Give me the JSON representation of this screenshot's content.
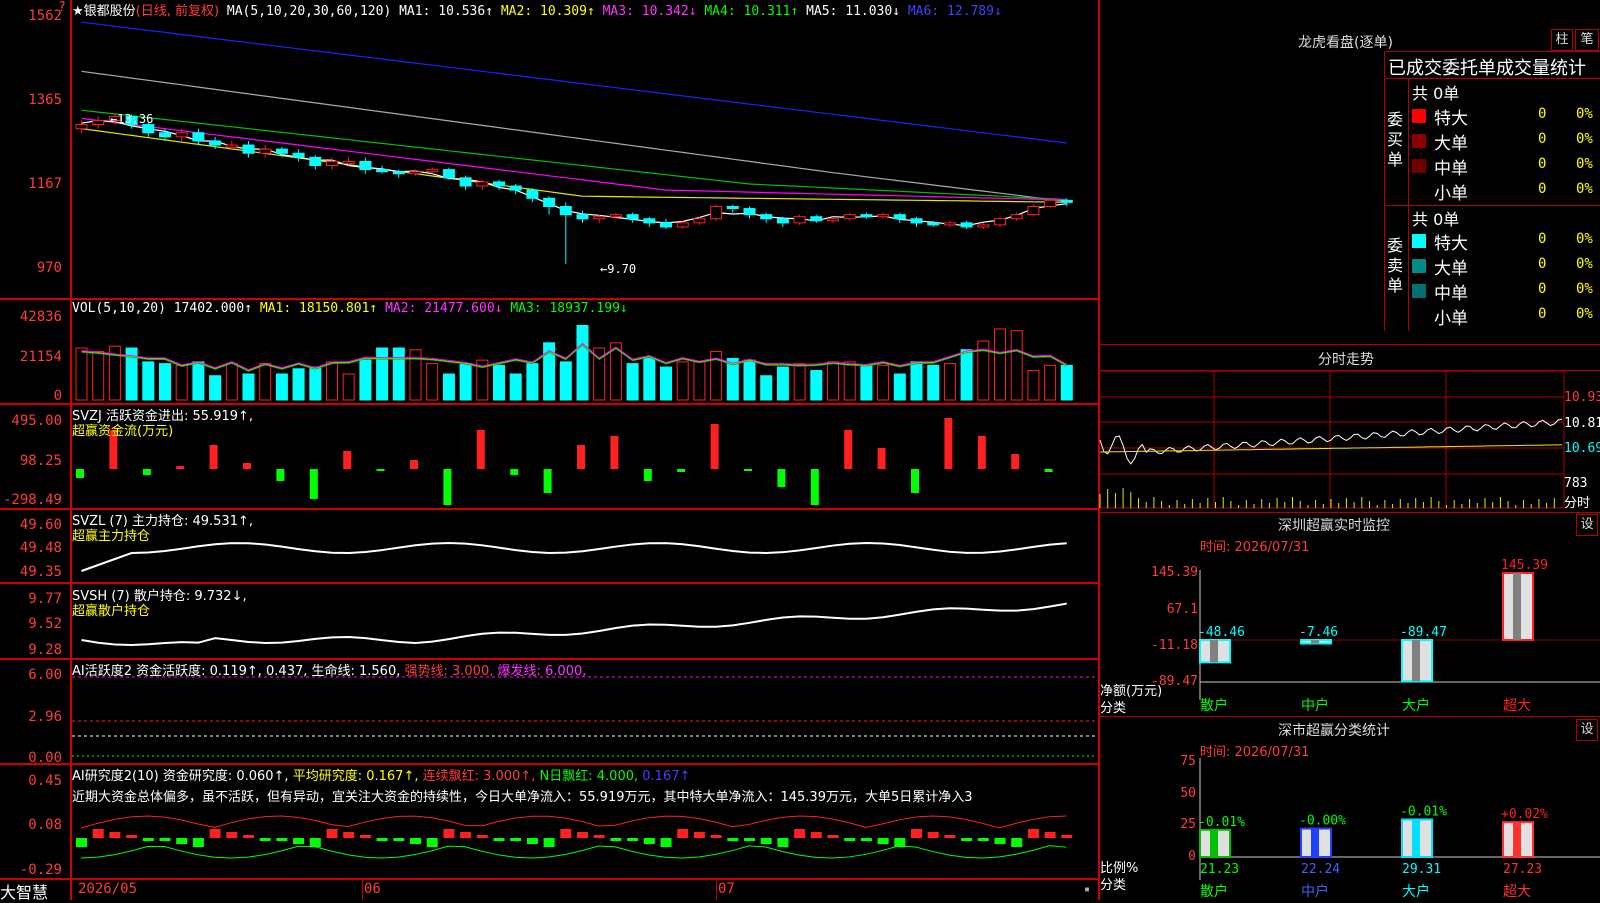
{
  "stock": {
    "name": "★银都股份",
    "mode": "(日线, 前复权)",
    "ma_label": "MA(5,10,20,30,60,120)",
    "ma1": "MA1: 10.536↑",
    "ma2": "MA2: 10.309↑",
    "ma3": "MA3: 10.342↓",
    "ma4": "MA4: 10.311↑",
    "ma5": "MA5: 11.030↓",
    "ma6": "MA6: 12.789↓"
  },
  "price_axis": [
    "1562",
    "1365",
    "1167",
    "970"
  ],
  "annotations": {
    "high": "←13.36",
    "low": "←9.70"
  },
  "vol": {
    "title": "VOL(5,10,20)",
    "val": "17402.000↑",
    "ma1": "MA1: 18150.801↑",
    "ma2": "MA2: 21477.600↓",
    "ma3": "MA3: 18937.199↓",
    "axis": [
      "42836",
      "21154",
      "0"
    ]
  },
  "svzj": {
    "title": "SVZJ  活跃资金进出: 55.919↑,",
    "sub": "超赢资金流(万元)",
    "axis": [
      "495.00",
      "98.25",
      "-298.49"
    ]
  },
  "svzl": {
    "title": "SVZL (7) 主力持仓: 49.531↑,",
    "sub": "超赢主力持仓",
    "axis": [
      "49.60",
      "49.48",
      "49.35"
    ]
  },
  "svsh": {
    "title": "SVSH (7) 散户持仓: 9.732↓,",
    "sub": "超赢散户持仓",
    "axis": [
      "9.77",
      "9.52",
      "9.28"
    ]
  },
  "ai2": {
    "title": "AI活跃度2 资金活跃度: 0.119↑, 0.437, 生命线: 1.560,",
    "strong": "强势线: 3.000,",
    "burst": "爆发线: 6.000,",
    "axis": [
      "6.00",
      "2.96",
      "0.00"
    ]
  },
  "ai_research": {
    "title": "AI研究度2(10) 资金研究度: 0.060↑,",
    "avg": "平均研究度: 0.167↑,",
    "cont": "连续飘红: 3.000↑,",
    "nday": "N日飘红: 4.000,",
    "last": "0.167↑",
    "text": "近期大资金总体偏多，虽不活跃，但有异动，宜关注大资金的持续性，今日大单净流入：55.919万元，其中特大单净流入：145.39万元，大单5日累计净入3",
    "axis": [
      "0.45",
      "0.08",
      "-0.29"
    ]
  },
  "bottom": {
    "brand": "大智慧",
    "dates": [
      "2026/05",
      "06",
      "07"
    ]
  },
  "longhu": {
    "title": "龙虎看盘(逐单)",
    "btn_zhu": "柱",
    "btn_bi": "笔",
    "tab": "已成交委托单成交量统计",
    "buy": {
      "label": "委买单",
      "total": "共 0单",
      "rows": [
        {
          "name": "特大",
          "n": "0",
          "pct": "0%",
          "color": "#ff0000"
        },
        {
          "name": "大单",
          "n": "0",
          "pct": "0%",
          "color": "#8b0000"
        },
        {
          "name": "中单",
          "n": "0",
          "pct": "0%",
          "color": "#6e0000"
        },
        {
          "name": "小单",
          "n": "0",
          "pct": "0%",
          "color": "#000000"
        }
      ]
    },
    "sell": {
      "label": "委卖单",
      "total": "共 0单",
      "rows": [
        {
          "name": "特大",
          "n": "0",
          "pct": "0%",
          "color": "#00ffff"
        },
        {
          "name": "大单",
          "n": "0",
          "pct": "0%",
          "color": "#008b8b"
        },
        {
          "name": "中单",
          "n": "0",
          "pct": "0%",
          "color": "#007070"
        },
        {
          "name": "小单",
          "n": "0",
          "pct": "0%",
          "color": "#000000"
        }
      ]
    }
  },
  "intraday": {
    "title": "分时走势",
    "axis": [
      "10.93",
      "10.81",
      "10.69"
    ],
    "vol_axis": "783",
    "vol_unit": "分时"
  },
  "monitor": {
    "title": "深圳超赢实时监控",
    "btn": "设",
    "time": "时间: 2026/07/31",
    "axis": [
      "145.39",
      "67.1",
      "-11.18",
      "-89.47"
    ],
    "ylabel": "净额(万元)",
    "xlabel": "分类",
    "bars": [
      {
        "cat": "散户",
        "value": -48.46,
        "label": "-48.46"
      },
      {
        "cat": "中户",
        "value": -7.46,
        "label": "-7.46"
      },
      {
        "cat": "大户",
        "value": -89.47,
        "label": "-89.47"
      },
      {
        "cat": "超大",
        "value": 145.39,
        "label": "145.39"
      }
    ]
  },
  "classify": {
    "title": "深市超赢分类统计",
    "btn": "设",
    "time": "时间: 2026/07/31",
    "axis": [
      "75",
      "50",
      "25",
      "0"
    ],
    "ylabel": "比例%",
    "xlabel": "分类",
    "bars": [
      {
        "cat": "散户",
        "value": 21.23,
        "label": "21.23",
        "delta": "-0.01%",
        "color": "#00c000"
      },
      {
        "cat": "中户",
        "value": 22.24,
        "label": "22.24",
        "delta": "-0.00%",
        "color": "#2040ff"
      },
      {
        "cat": "大户",
        "value": 29.31,
        "label": "29.31",
        "delta": "-0.01%",
        "color": "#00e0ff"
      },
      {
        "cat": "超大",
        "value": 27.23,
        "label": "27.23",
        "delta": "+0.02%",
        "color": "#ff3030"
      }
    ]
  },
  "chart_data": {
    "type": "bar",
    "candles": [
      [
        13.0,
        13.1,
        12.9,
        13.2
      ],
      [
        13.1,
        13.2,
        13.0,
        13.3
      ],
      [
        13.2,
        13.3,
        13.1,
        13.36
      ],
      [
        13.3,
        13.1,
        13.0,
        13.35
      ],
      [
        13.1,
        12.9,
        12.8,
        13.15
      ],
      [
        12.9,
        12.8,
        12.7,
        13.0
      ],
      [
        12.8,
        12.9,
        12.7,
        13.0
      ],
      [
        12.9,
        12.7,
        12.6,
        13.0
      ],
      [
        12.7,
        12.6,
        12.5,
        12.8
      ],
      [
        12.6,
        12.6,
        12.5,
        12.7
      ],
      [
        12.6,
        12.4,
        12.3,
        12.7
      ],
      [
        12.4,
        12.5,
        12.3,
        12.6
      ],
      [
        12.5,
        12.4,
        12.3,
        12.55
      ],
      [
        12.4,
        12.3,
        12.2,
        12.5
      ],
      [
        12.3,
        12.1,
        12.0,
        12.35
      ],
      [
        12.1,
        12.2,
        12.0,
        12.3
      ],
      [
        12.2,
        12.2,
        12.1,
        12.3
      ],
      [
        12.2,
        12.0,
        11.9,
        12.3
      ],
      [
        12.0,
        11.95,
        11.9,
        12.1
      ],
      [
        11.95,
        11.9,
        11.8,
        12.0
      ],
      [
        11.9,
        11.95,
        11.85,
        12.0
      ],
      [
        11.95,
        12.0,
        11.9,
        12.05
      ],
      [
        12.0,
        11.8,
        11.75,
        12.05
      ],
      [
        11.8,
        11.6,
        11.5,
        11.85
      ],
      [
        11.6,
        11.7,
        11.5,
        11.75
      ],
      [
        11.7,
        11.6,
        11.5,
        11.75
      ],
      [
        11.6,
        11.5,
        11.4,
        11.65
      ],
      [
        11.5,
        11.3,
        11.2,
        11.55
      ],
      [
        11.3,
        11.1,
        10.9,
        11.35
      ],
      [
        11.1,
        10.9,
        9.7,
        11.2
      ],
      [
        10.9,
        10.8,
        10.7,
        11.0
      ],
      [
        10.8,
        10.85,
        10.7,
        10.9
      ],
      [
        10.85,
        10.9,
        10.8,
        10.95
      ],
      [
        10.9,
        10.8,
        10.7,
        10.95
      ],
      [
        10.8,
        10.7,
        10.6,
        10.85
      ],
      [
        10.7,
        10.6,
        10.55,
        10.8
      ],
      [
        10.6,
        10.7,
        10.55,
        10.75
      ],
      [
        10.7,
        10.8,
        10.65,
        10.85
      ],
      [
        10.8,
        11.1,
        10.75,
        11.15
      ],
      [
        11.1,
        11.05,
        10.95,
        11.15
      ],
      [
        11.05,
        10.9,
        10.8,
        11.1
      ],
      [
        10.9,
        10.8,
        10.7,
        10.95
      ],
      [
        10.8,
        10.7,
        10.6,
        10.85
      ],
      [
        10.7,
        10.85,
        10.65,
        10.9
      ],
      [
        10.85,
        10.75,
        10.7,
        10.9
      ],
      [
        10.75,
        10.8,
        10.7,
        10.85
      ],
      [
        10.8,
        10.9,
        10.75,
        10.95
      ],
      [
        10.9,
        10.85,
        10.8,
        10.95
      ],
      [
        10.85,
        10.9,
        10.8,
        10.95
      ],
      [
        10.9,
        10.8,
        10.7,
        10.95
      ],
      [
        10.8,
        10.7,
        10.6,
        10.85
      ],
      [
        10.7,
        10.65,
        10.6,
        10.75
      ],
      [
        10.65,
        10.7,
        10.6,
        10.75
      ],
      [
        10.7,
        10.6,
        10.55,
        10.75
      ],
      [
        10.6,
        10.65,
        10.55,
        10.7
      ],
      [
        10.65,
        10.8,
        10.6,
        10.85
      ],
      [
        10.8,
        10.9,
        10.75,
        10.95
      ],
      [
        10.9,
        11.1,
        10.85,
        11.15
      ],
      [
        11.1,
        11.25,
        11.05,
        11.3
      ],
      [
        11.25,
        11.2,
        11.1,
        11.3
      ]
    ],
    "volume": [
      30,
      28,
      31,
      30,
      22,
      21,
      20,
      22,
      14,
      21,
      15,
      21,
      15,
      18,
      19,
      22,
      15,
      23,
      30,
      30,
      29,
      21,
      15,
      21,
      23,
      20,
      15,
      21,
      33,
      22,
      43,
      30,
      33,
      21,
      24,
      19,
      22,
      22,
      28,
      24,
      23,
      14,
      19,
      21,
      17,
      22,
      22,
      20,
      20,
      15,
      22,
      20,
      21,
      29,
      34,
      41,
      40,
      17,
      20,
      20
    ]
  }
}
